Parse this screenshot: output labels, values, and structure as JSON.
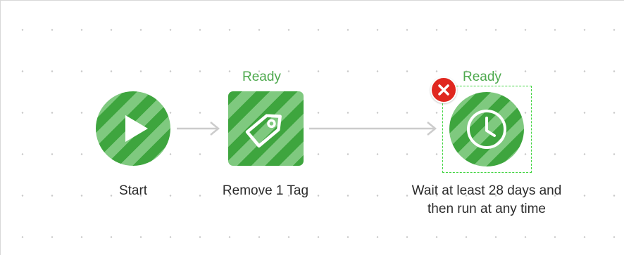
{
  "workflow": {
    "nodes": {
      "start": {
        "label": "Start",
        "icon": "play-icon"
      },
      "remove_tag": {
        "label": "Remove 1 Tag",
        "status": "Ready",
        "icon": "tag-icon"
      },
      "wait": {
        "label_line1": "Wait at least 28 days and",
        "label_line2": "then run at any time",
        "status": "Ready",
        "icon": "clock-icon"
      }
    },
    "delete_icon": "close-icon"
  },
  "colors": {
    "node_dark": "#3ea53e",
    "node_light": "#7fc97f",
    "status_text": "#4ea94e",
    "selection_border": "#3fd43f",
    "delete_button": "#e0271f",
    "connector": "#cccccc"
  }
}
